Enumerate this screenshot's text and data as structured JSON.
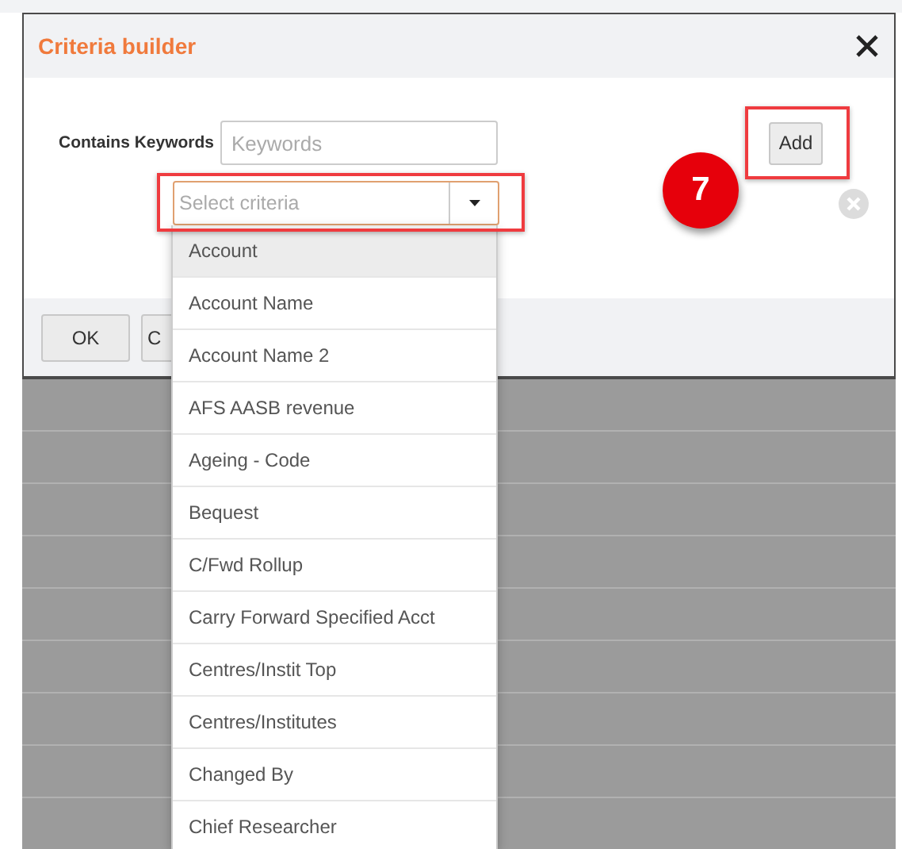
{
  "dialog": {
    "title": "Criteria builder",
    "keywords": {
      "label": "Contains Keywords",
      "placeholder": "Keywords"
    },
    "criteria_select": {
      "placeholder": "Select criteria",
      "expanded": true,
      "options": [
        {
          "label": "Account",
          "selected": true
        },
        {
          "label": "Account Name",
          "selected": false
        },
        {
          "label": "Account Name 2",
          "selected": false
        },
        {
          "label": "AFS AASB revenue",
          "selected": false
        },
        {
          "label": "Ageing - Code",
          "selected": false
        },
        {
          "label": "Bequest",
          "selected": false
        },
        {
          "label": "C/Fwd Rollup",
          "selected": false
        },
        {
          "label": "Carry Forward Specified Acct",
          "selected": false
        },
        {
          "label": "Centres/Instit Top",
          "selected": false
        },
        {
          "label": "Centres/Institutes",
          "selected": false
        },
        {
          "label": "Changed By",
          "selected": false
        },
        {
          "label": "Chief Researcher",
          "selected": false
        }
      ]
    },
    "add_button": "Add",
    "footer_buttons": [
      "OK",
      "C"
    ]
  },
  "callout": {
    "number": "7"
  }
}
